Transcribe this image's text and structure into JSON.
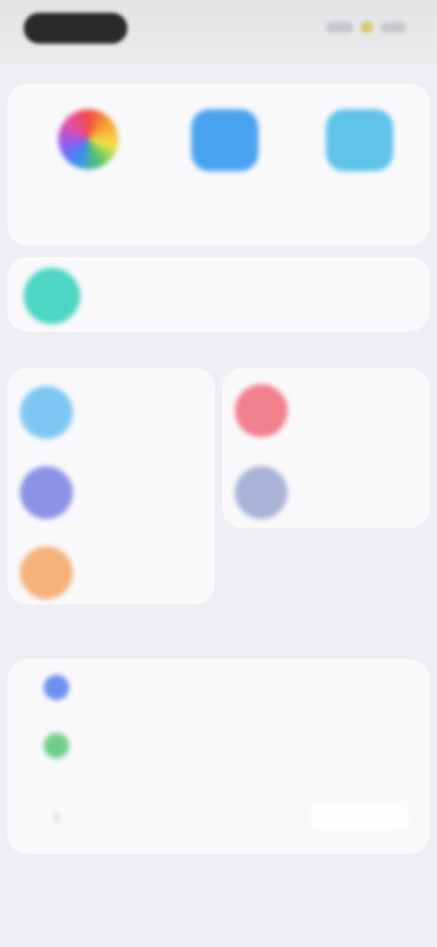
{
  "statusbar": {
    "icons": [
      "signal-icon",
      "wifi-icon",
      "battery-icon"
    ]
  },
  "top_actions": [
    {
      "name": "color-wheel",
      "label": "",
      "color": "conic"
    },
    {
      "name": "blue-square",
      "label": "",
      "color": "#4aa3f0"
    },
    {
      "name": "light-blue-square",
      "label": "",
      "color": "#5fc3ea"
    }
  ],
  "banner": {
    "text": "",
    "color": "#4dd6c3"
  },
  "tiles": [
    {
      "label": "",
      "color": "#7cc8f2"
    },
    {
      "label": "",
      "color": "#f27f8c"
    },
    {
      "label": "",
      "color": "#8c93e6"
    },
    {
      "label": "",
      "color": "#aab3d6"
    },
    {
      "label": "",
      "color": "#f5b37a"
    }
  ],
  "list_section": {
    "caption": "",
    "rows": [
      {
        "label": "",
        "color": "#6f8ff0"
      },
      {
        "label": "",
        "color": "#6fcf8a"
      },
      {
        "label": "",
        "color": "#bbbbbb"
      }
    ]
  }
}
